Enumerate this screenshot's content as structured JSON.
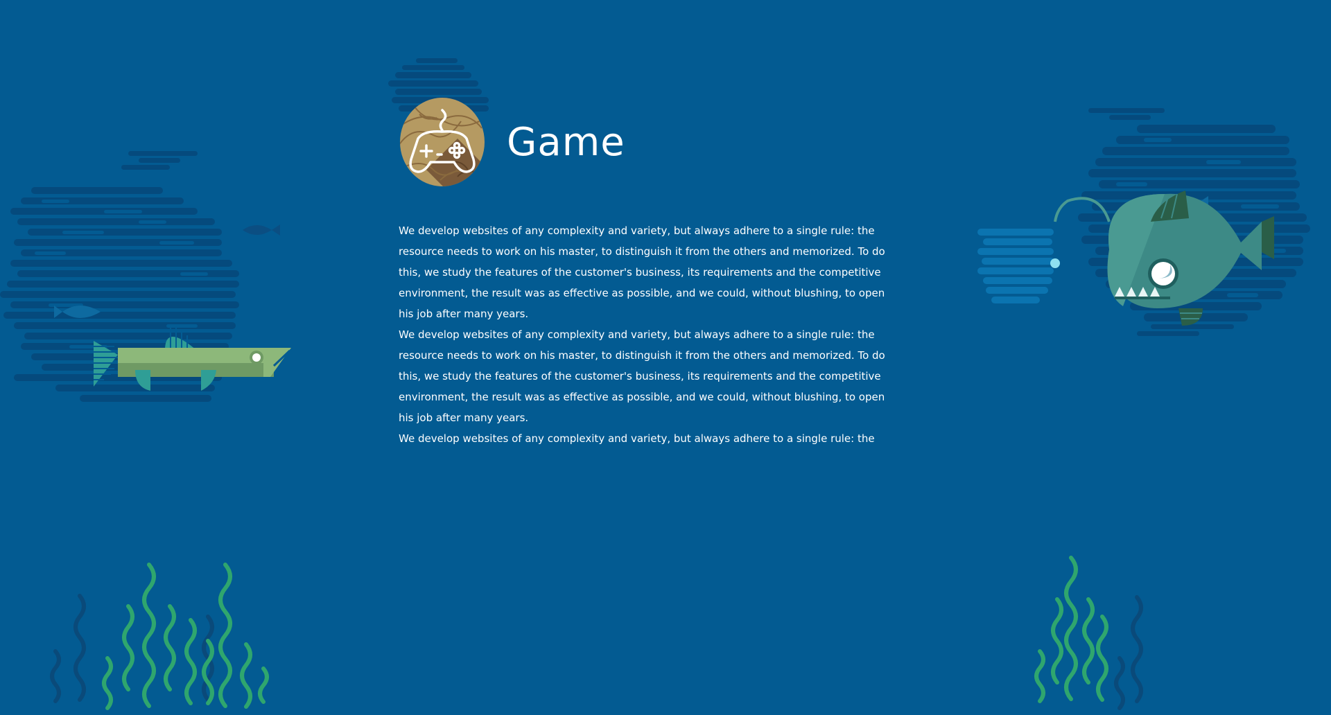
{
  "page": {
    "title": "Game",
    "icon": "gamepad-icon",
    "paragraphs": [
      "We develop websites of any complexity and variety, but always adhere to a single rule: the resource needs to work on his master, to distinguish it from the others and memorized. To do this, we study the features of the customer's business, its requirements and the competitive environment, the result was as effective as possible, and we could, without blushing, to open his job after many years.",
      "We develop websites of any complexity and variety, but always adhere to a single rule: the resource needs to work on his master, to distinguish it from the others and memorized. To do this, we study the features of the customer's business, its requirements and the competitive environment, the result was as effective as possible, and we could, without blushing, to open his job after many years.",
      "We develop websites of any complexity and variety, but always adhere to a single rule: the"
    ]
  },
  "colors": {
    "background": "#035b92",
    "dark_water": "#054a7d",
    "seaweed": "#2fa66e",
    "seaweed_dark": "#0a4a7a",
    "pike_fish": "#8db87a",
    "angler_fish": "#3d8a86",
    "icon_wood": "#b59a62"
  },
  "decorations": {
    "left_fish": "pike-fish-icon",
    "right_fish": "angler-fish-icon",
    "left_plants": "seaweed-icon",
    "right_plants": "seaweed-icon",
    "small_fish": "small-fish-icon"
  }
}
